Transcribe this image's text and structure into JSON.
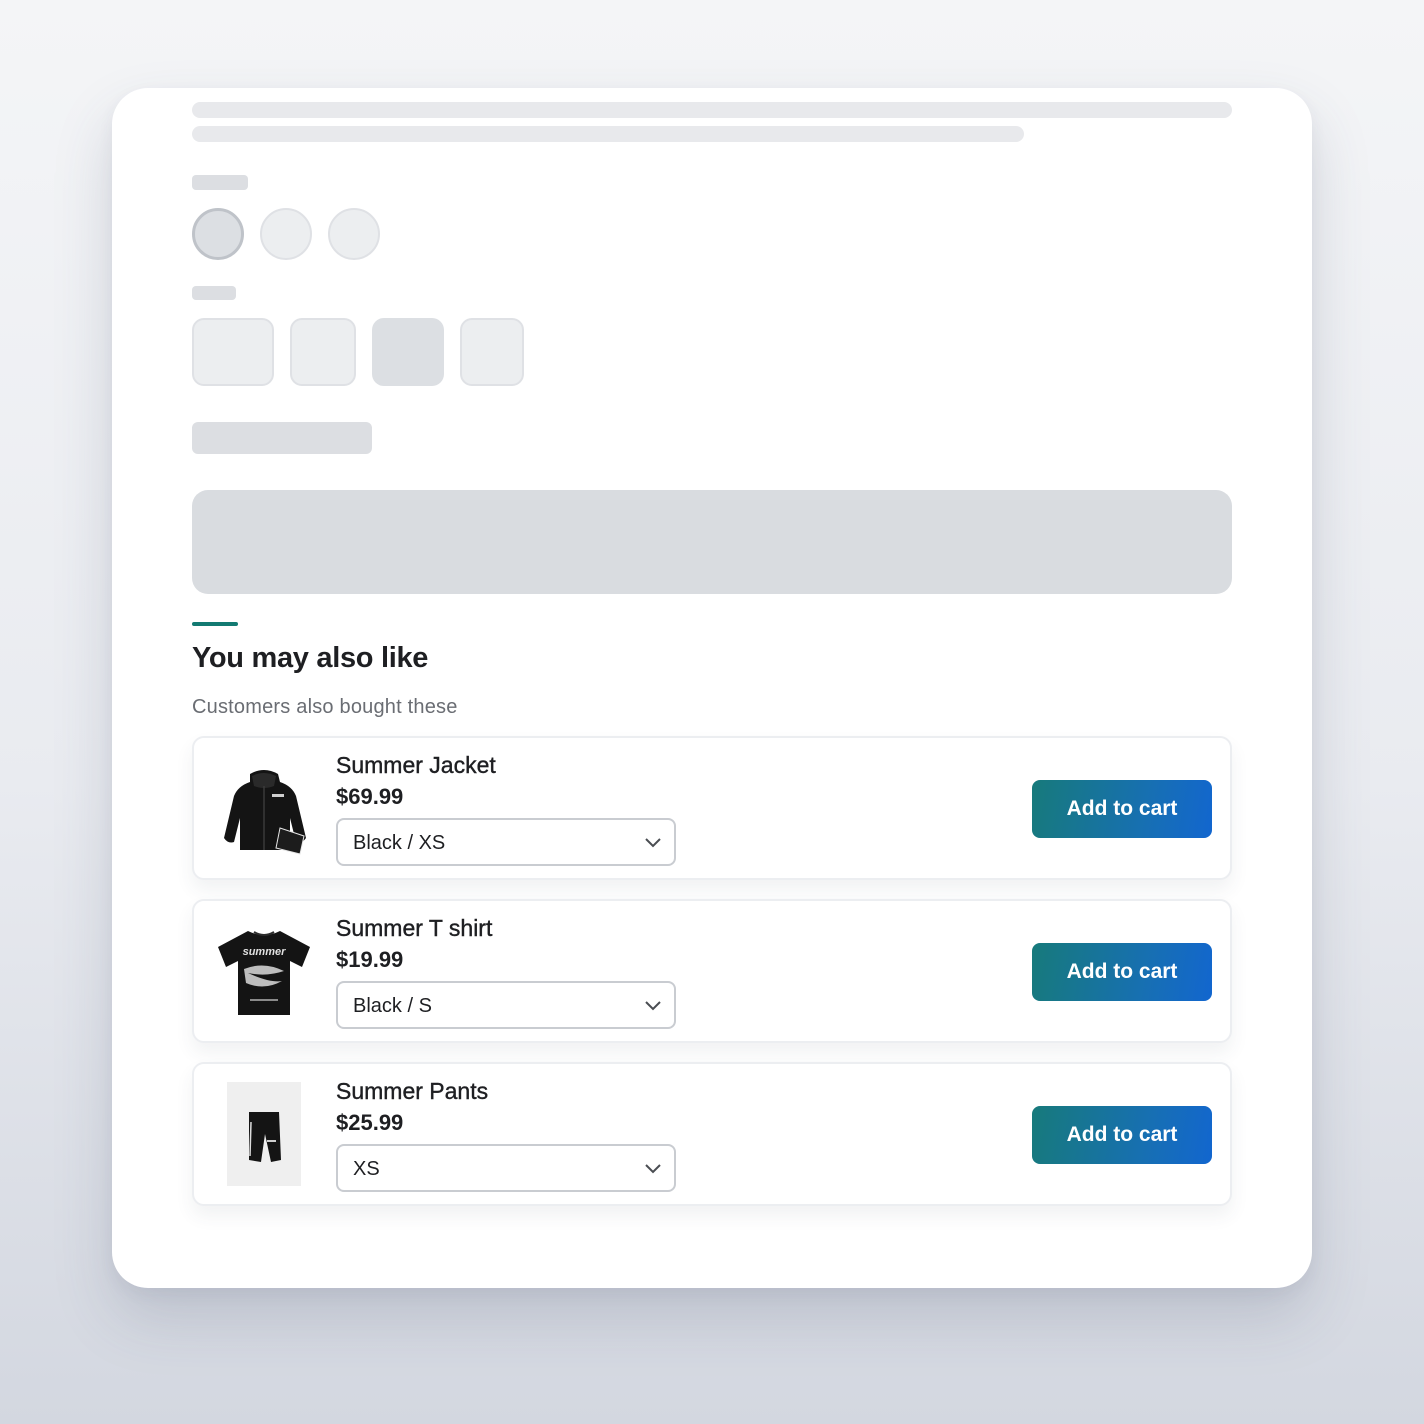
{
  "section": {
    "title": "You may also like",
    "subtitle": "Customers also bought these"
  },
  "colors": {
    "accent": "#127a72",
    "button_gradient_start": "#177a7b",
    "button_gradient_end": "#1266cf"
  },
  "recommendations": [
    {
      "name": "Summer Jacket",
      "price": "$69.99",
      "variant": "Black / XS",
      "button": "Add to cart",
      "image": "jacket-image"
    },
    {
      "name": "Summer T shirt",
      "price": "$19.99",
      "variant": "Black / S",
      "button": "Add to cart",
      "image": "tshirt-image"
    },
    {
      "name": "Summer Pants",
      "price": "$25.99",
      "variant": "XS",
      "button": "Add to cart",
      "image": "shorts-image"
    }
  ]
}
